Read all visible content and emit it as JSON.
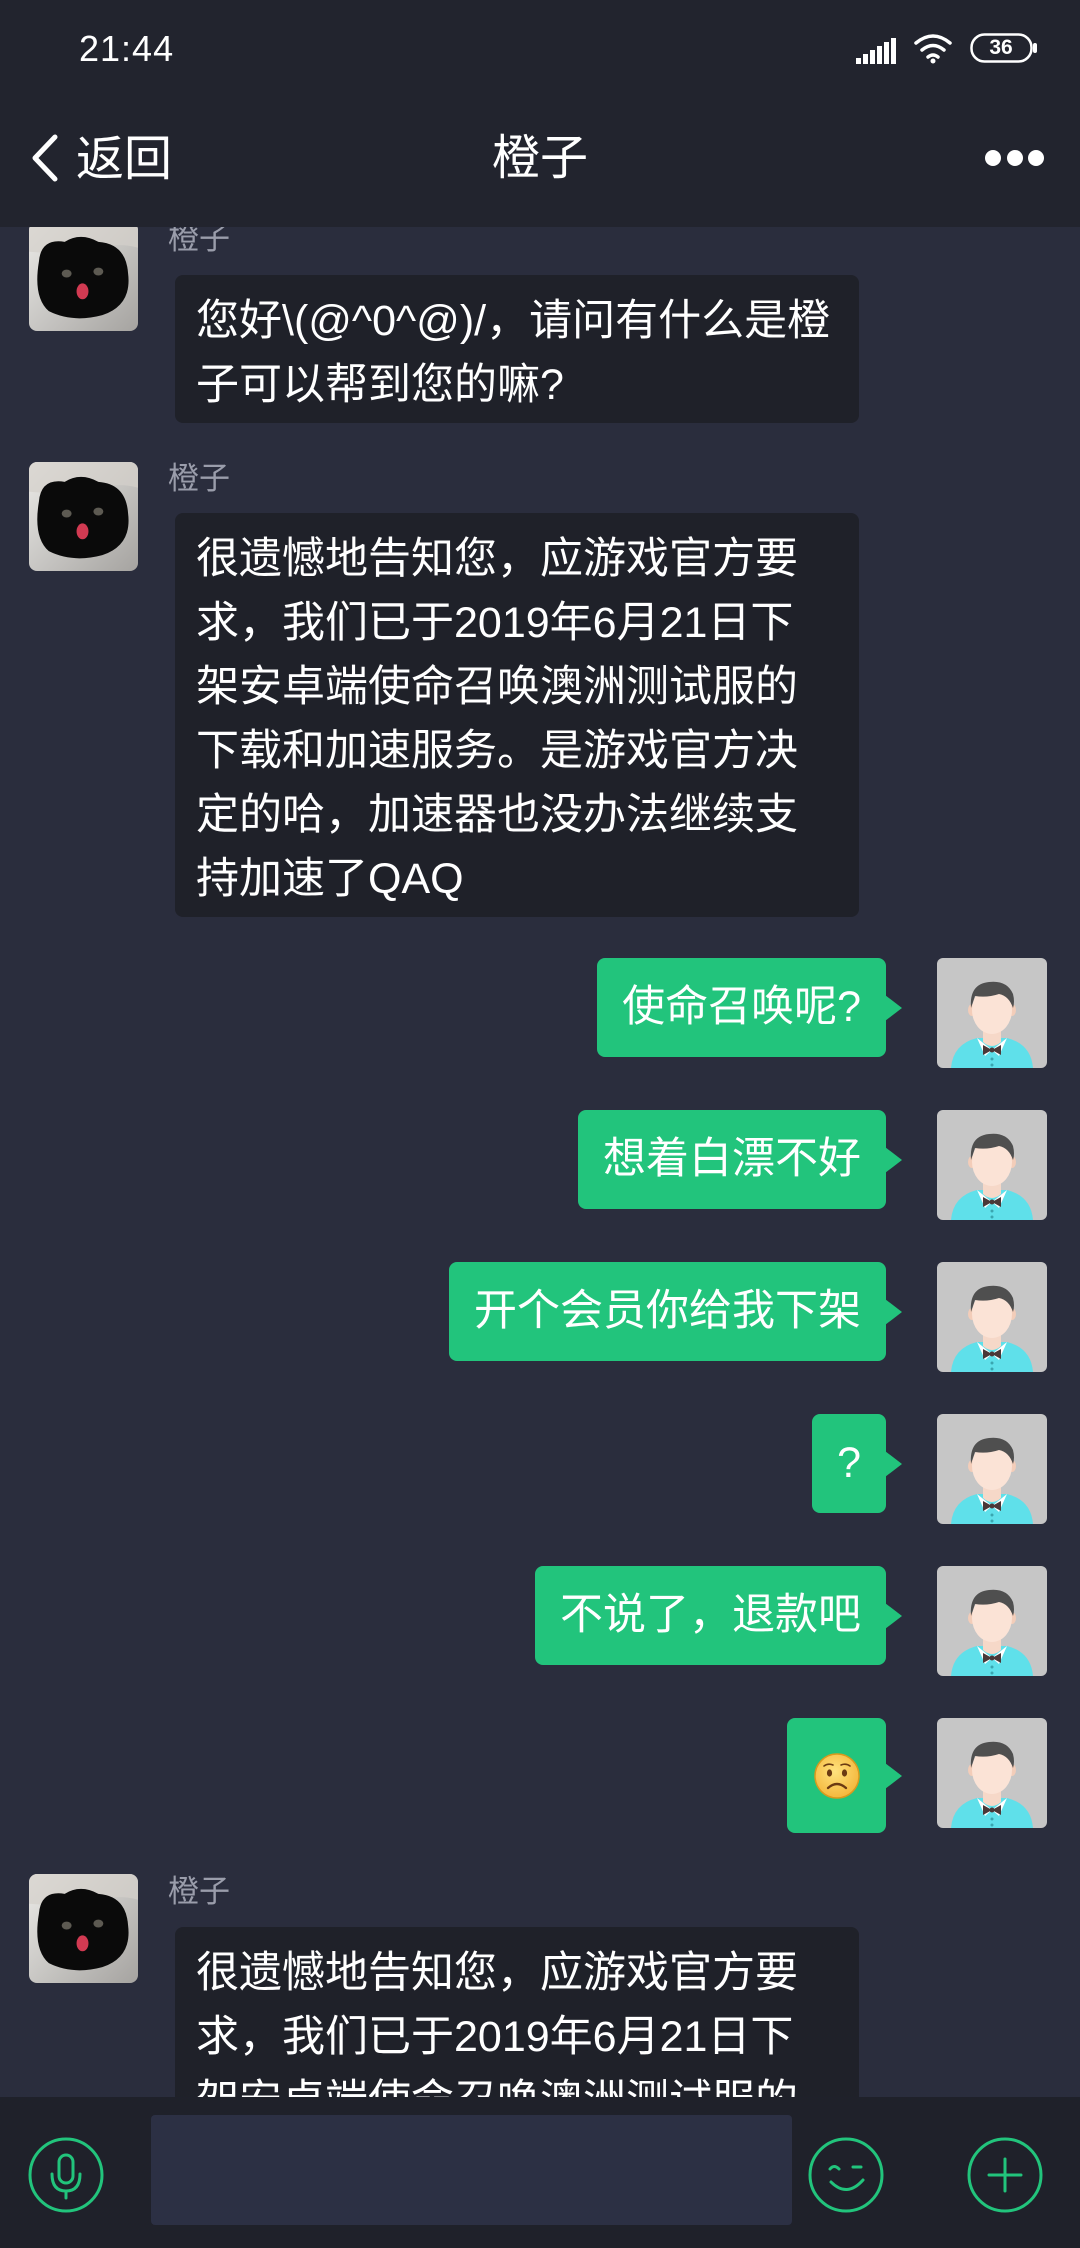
{
  "status_bar": {
    "time": "21:44",
    "battery_level": "36",
    "signal_icon": "signal-icon",
    "wifi_icon": "wifi-icon",
    "battery_icon": "battery-icon"
  },
  "header": {
    "back_icon": "chevron-left-icon",
    "back_label": "返回",
    "title": "橙子",
    "more_icon": "more-dots-icon"
  },
  "messages": [
    {
      "outgoing": false,
      "sender": "橙子",
      "avatar_icon": "cat-photo-avatar",
      "lines": [
        "您好\\(@^0^@)/，请问有什么是橙",
        "子可以帮到您的嘛?"
      ]
    },
    {
      "outgoing": false,
      "sender": "橙子",
      "avatar_icon": "cat-photo-avatar",
      "lines": [
        "很遗憾地告知您，应游戏官方要",
        "求，我们已于2019年6月21日下",
        "架安卓端使命召唤澳洲测试服的",
        "下载和加速服务。是游戏官方决",
        "定的哈，加速器也没办法继续支",
        "持加速了QAQ"
      ]
    },
    {
      "outgoing": true,
      "avatar_icon": "default-user-avatar",
      "text": "使命召唤呢?"
    },
    {
      "outgoing": true,
      "avatar_icon": "default-user-avatar",
      "text": "想着白漂不好"
    },
    {
      "outgoing": true,
      "avatar_icon": "default-user-avatar",
      "text": "开个会员你给我下架"
    },
    {
      "outgoing": true,
      "avatar_icon": "default-user-avatar",
      "text": "?"
    },
    {
      "outgoing": true,
      "avatar_icon": "default-user-avatar",
      "text": "不说了，退款吧"
    },
    {
      "outgoing": true,
      "avatar_icon": "default-user-avatar",
      "emoji_icon": "frowning-face-emoji"
    },
    {
      "outgoing": false,
      "sender": "橙子",
      "avatar_icon": "cat-photo-avatar",
      "lines": [
        "很遗憾地告知您，应游戏官方要",
        "求，我们已于2019年6月21日下",
        "架安卓端使命召唤澳洲测试服的"
      ]
    }
  ],
  "input_bar": {
    "voice_icon": "microphone-icon",
    "message_value": "",
    "emoji_icon": "emoji-wink-icon",
    "more_icon": "plus-icon"
  },
  "colors": {
    "header_bg": "#22242e",
    "chat_bg": "#2a2d3d",
    "in_bubble": "#1f2129",
    "out_bubble": "#22c47c",
    "accent": "#22c47c",
    "name_text": "#9a9dab",
    "input_bar_bg": "#1f212a",
    "input_field_bg": "#2c3044"
  }
}
